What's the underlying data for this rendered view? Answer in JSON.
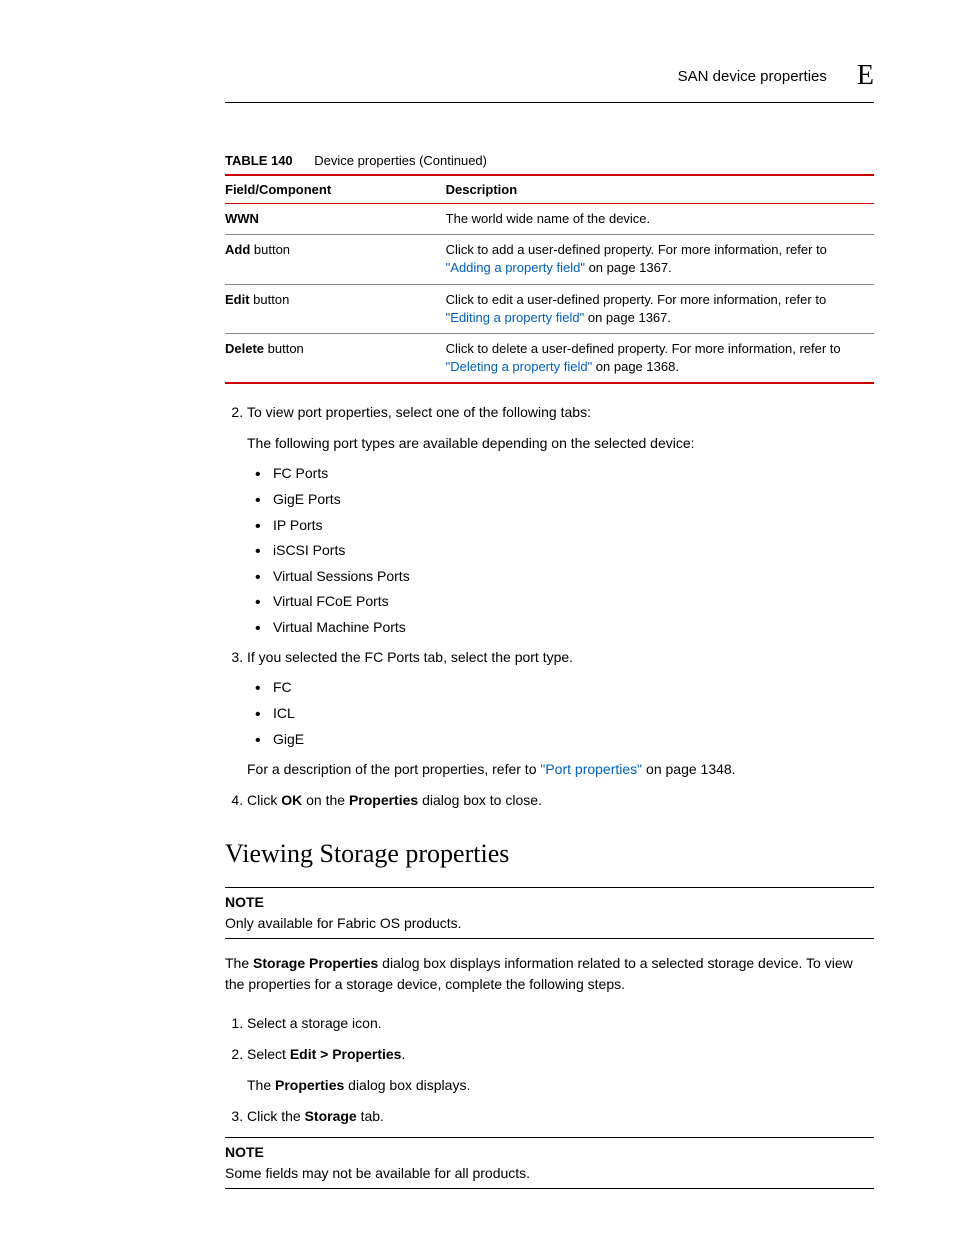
{
  "header": {
    "title": "SAN device properties",
    "letter": "E"
  },
  "table": {
    "label": "TABLE 140",
    "caption": "Device properties (Continued)",
    "head_field": "Field/Component",
    "head_desc": "Description",
    "rows": [
      {
        "field_bold": "WWN",
        "field_plain": "",
        "desc_pre": "The world wide name of the device.",
        "link": "",
        "desc_post": ""
      },
      {
        "field_bold": "Add",
        "field_plain": " button",
        "desc_pre": "Click to add a user-defined property. For more information, refer to ",
        "link": "\"Adding a property field\"",
        "desc_post": " on page 1367."
      },
      {
        "field_bold": "Edit",
        "field_plain": " button",
        "desc_pre": "Click to edit a user-defined property. For more information, refer to ",
        "link": "\"Editing a property field\"",
        "desc_post": " on page 1367."
      },
      {
        "field_bold": "Delete",
        "field_plain": " button",
        "desc_pre": "Click to delete a user-defined property. For more information, refer to ",
        "link": "\"Deleting a property field\"",
        "desc_post": " on page 1368."
      }
    ]
  },
  "steps_a": {
    "s2_intro": "To view port properties, select one of the following tabs:",
    "s2_sub": "The following port types are available depending on the selected device:",
    "s2_bullets": [
      "FC Ports",
      "GigE Ports",
      "IP Ports",
      "iSCSI Ports",
      "Virtual Sessions Ports",
      "Virtual FCoE Ports",
      "Virtual Machine Ports"
    ],
    "s3_intro": "If you selected the FC Ports tab, select the port type.",
    "s3_bullets": [
      "FC",
      "ICL",
      "GigE"
    ],
    "s3_ref_pre": "For a description of the port properties, refer to ",
    "s3_ref_link": "\"Port properties\"",
    "s3_ref_post": " on page 1348.",
    "s4_pre": "Click ",
    "s4_b1": "OK",
    "s4_mid": " on the ",
    "s4_b2": "Properties",
    "s4_post": " dialog box to close."
  },
  "section2": {
    "title": "Viewing Storage properties",
    "note1_label": "NOTE",
    "note1_text": "Only available for Fabric OS products.",
    "intro_pre": "The ",
    "intro_b": "Storage Properties",
    "intro_post": " dialog box displays information related to a selected storage device. To view the properties for a storage device, complete the following steps.",
    "s1": "Select a storage icon.",
    "s2_pre": "Select ",
    "s2_b": "Edit > Properties",
    "s2_post": ".",
    "s2_sub_pre": "The ",
    "s2_sub_b": "Properties",
    "s2_sub_post": " dialog box displays.",
    "s3_pre": "Click the ",
    "s3_b": "Storage",
    "s3_post": " tab.",
    "note2_label": "NOTE",
    "note2_text": "Some fields may not be available for all products."
  }
}
